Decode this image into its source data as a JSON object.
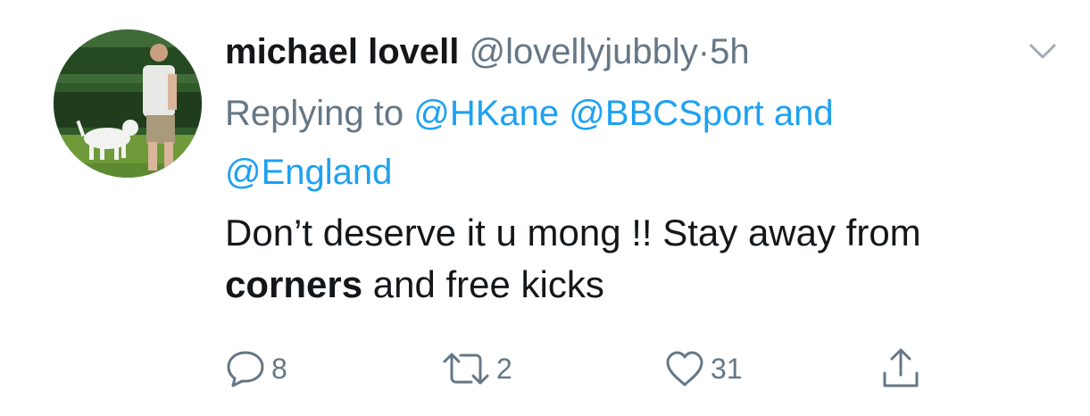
{
  "tweet": {
    "author": {
      "display_name": "michael lovell",
      "handle": "@lovellyjubbly",
      "separator": "·",
      "time": "5h"
    },
    "reply_context": {
      "prefix": "Replying to",
      "mention_1": "@HKane",
      "mention_2": "@BBCSport",
      "conjunction": "and",
      "mention_3": "@England"
    },
    "text": {
      "part_1": "Don’t deserve it u mong !! Stay away from ",
      "bold": "corners",
      "part_2": " and free kicks"
    },
    "actions": {
      "reply_count": "8",
      "retweet_count": "2",
      "like_count": "31"
    },
    "icons": {
      "reply": "speech-bubble-icon",
      "retweet": "retweet-arrows-icon",
      "like": "heart-icon",
      "share": "share-upload-icon",
      "menu": "chevron-down-icon"
    },
    "colors": {
      "link": "#1da1f2",
      "muted": "#657786",
      "text": "#14171a"
    }
  }
}
